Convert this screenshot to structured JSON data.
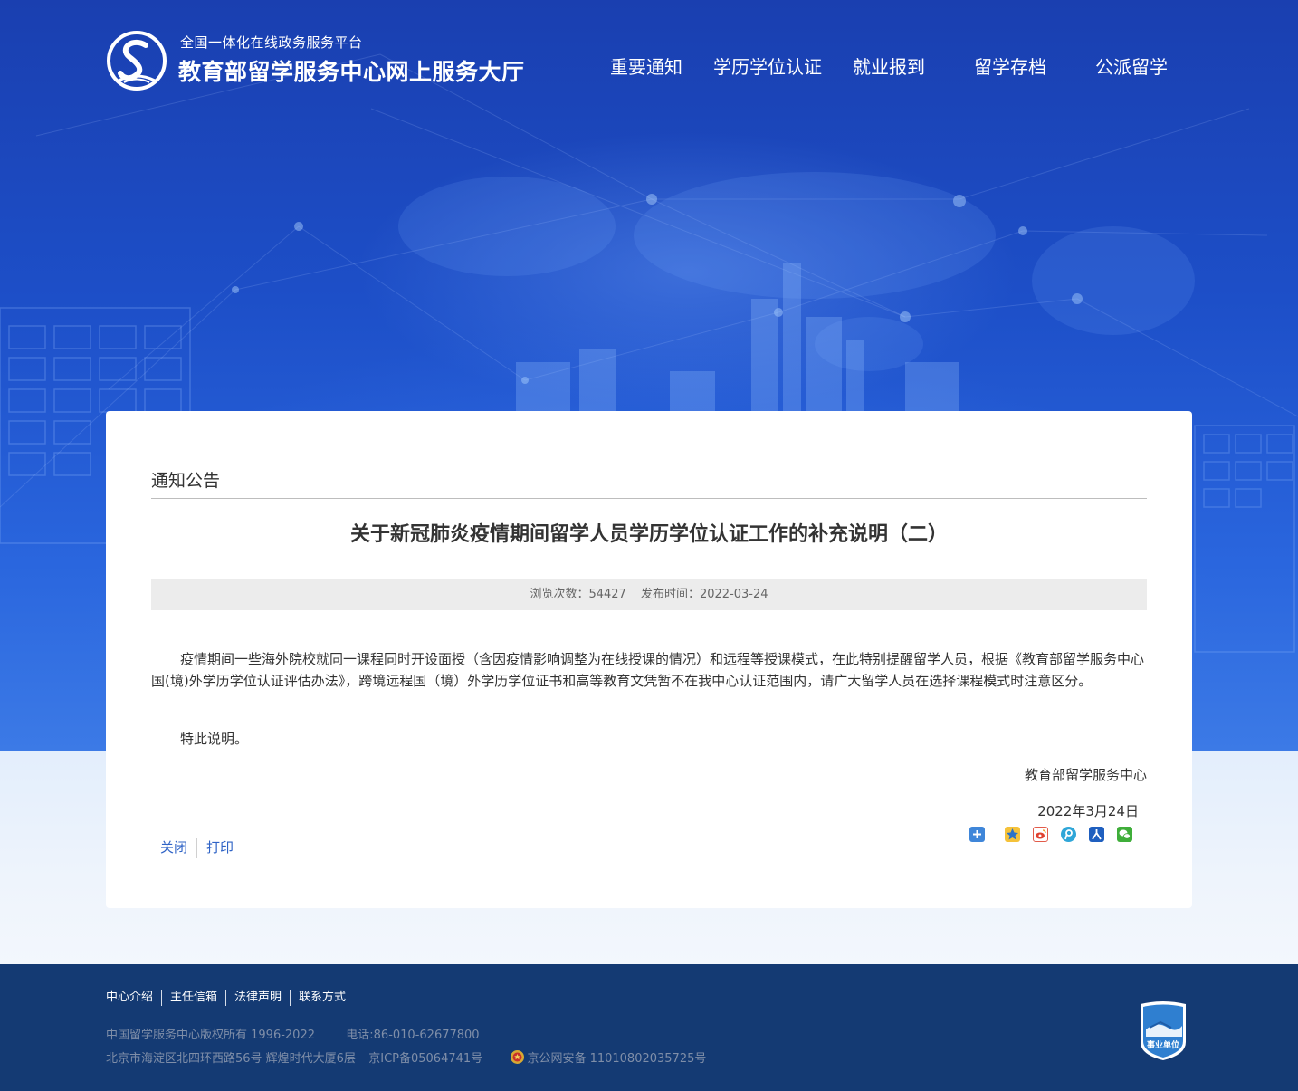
{
  "header": {
    "platform_subtitle": "全国一体化在线政务服务平台",
    "site_title": "教育部留学服务中心网上服务大厅",
    "nav": [
      {
        "label": "重要通知"
      },
      {
        "label": "学历学位认证"
      },
      {
        "label": "就业报到"
      },
      {
        "label": "留学存档"
      },
      {
        "label": "公派留学"
      }
    ]
  },
  "article": {
    "section": "通知公告",
    "title": "关于新冠肺炎疫情期间留学人员学历学位认证工作的补充说明（二）",
    "views_label": "浏览次数：",
    "views": "54427",
    "published_label": "发布时间：",
    "published": "2022-03-24",
    "paragraphs": [
      "疫情期间一些海外院校就同一课程同时开设面授（含因疫情影响调整为在线授课的情况）和远程等授课模式，在此特别提醒留学人员，根据《教育部留学服务中心国(境)外学历学位认证评估办法》，跨境远程国（境）外学历学位证书和高等教育文凭暂不在我中心认证范围内，请广大留学人员在选择课程模式时注意区分。",
      "特此说明。"
    ],
    "signature": "教育部留学服务中心",
    "signature_date": "2022年3月24日",
    "actions": {
      "close": "关闭",
      "print": "打印"
    },
    "share_icons": [
      "add-more-icon",
      "qzone-icon",
      "weibo-icon",
      "tencent-weibo-icon",
      "renren-icon",
      "wechat-icon"
    ]
  },
  "footer": {
    "links": [
      {
        "label": "中心介绍"
      },
      {
        "label": "主任信箱"
      },
      {
        "label": "法律声明"
      },
      {
        "label": "联系方式"
      }
    ],
    "copyright": "中国留学服务中心版权所有 1996-2022",
    "phone": "电话:86-010-62677800",
    "address": "北京市海淀区北四环西路56号 辉煌时代大厦6层",
    "icp": "京ICP备05064741号",
    "police": "京公网安备 11010802035725号",
    "badge_text": "事业单位"
  },
  "colors": {
    "hero_blue": "#1d4fc8",
    "link_blue": "#2f63c6",
    "footer_navy": "#143a73"
  }
}
